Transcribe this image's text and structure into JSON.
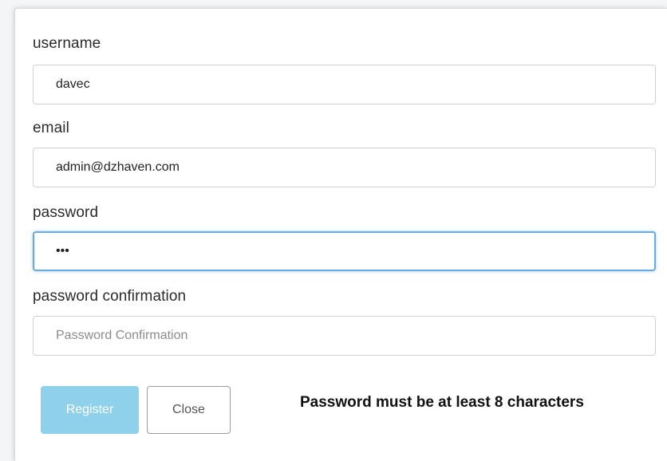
{
  "form": {
    "username": {
      "label": "username",
      "value": "davec",
      "placeholder": ""
    },
    "email": {
      "label": "email",
      "value": "admin@dzhaven.com",
      "placeholder": ""
    },
    "password": {
      "label": "password",
      "value": "•••",
      "placeholder": ""
    },
    "password_confirmation": {
      "label": "password confirmation",
      "value": "",
      "placeholder": "Password Confirmation"
    }
  },
  "buttons": {
    "register_label": "Register",
    "close_label": "Close"
  },
  "validation_message": "Password must be at least 8 characters",
  "colors": {
    "register_bg": "#8fd0ea",
    "focus_border": "#6aa9e0"
  }
}
